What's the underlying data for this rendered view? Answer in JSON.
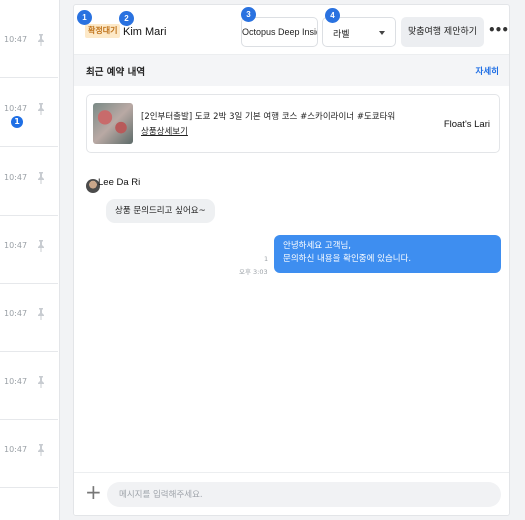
{
  "conversation_list": {
    "rows": [
      {
        "time": "10:47",
        "unread": ""
      },
      {
        "time": "10:47",
        "unread": "1"
      },
      {
        "time": "10:47",
        "unread": ""
      },
      {
        "time": "10:47",
        "unread": ""
      },
      {
        "time": "10:47",
        "unread": ""
      },
      {
        "time": "10:47",
        "unread": ""
      },
      {
        "time": "10:47",
        "unread": ""
      }
    ]
  },
  "header": {
    "badges": [
      "1",
      "2",
      "3",
      "4"
    ],
    "status_badge": "확정대기",
    "customer_name": "Kim Mari",
    "product_button": "Octopus Deep Inside",
    "label_select": "라벨",
    "propose_button": "맞춤여행 제안하기",
    "more_button": "•••"
  },
  "booking": {
    "section_title": "최근 예약 내역",
    "detail_link": "자세히",
    "product_title": "[2인부터출발] 도쿄 2박 3일 기본 여행 코스 #스카이라이너 #도쿄타워",
    "product_link": "상품상세보기",
    "partner_name": "Float's Lari"
  },
  "messages": {
    "incoming": {
      "sender": "Lee Da Ri",
      "text": "상품 문의드리고 싶어요~"
    },
    "outgoing": {
      "line1": "안녕하세요 고객님,",
      "line2": "문의하신 내용을 확인중에 있습니다.",
      "read_count": "1",
      "time": "오후 3:03"
    }
  },
  "composer": {
    "plus": "+",
    "placeholder": "메시지를 입력해주세요."
  },
  "colors": {
    "accent": "#1f6fe5",
    "outgoing_bubble": "#3e8ef0",
    "status_badge_bg": "#fde9c8",
    "status_badge_text": "#c0731a"
  }
}
